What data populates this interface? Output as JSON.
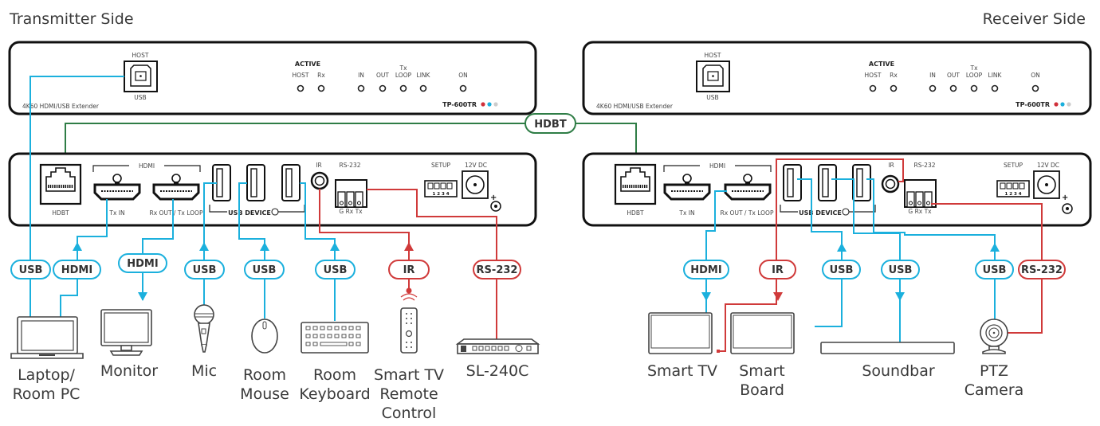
{
  "titles": {
    "transmitter": "Transmitter Side",
    "receiver": "Receiver Side"
  },
  "front_panel": {
    "host_label": "HOST",
    "usb_label": "USB",
    "product_desc": "4K60 HDMI/USB Extender",
    "active_label": "ACTIVE",
    "leds": [
      "HOST",
      "Rx",
      "IN",
      "OUT",
      "LOOP",
      "LINK",
      "ON"
    ],
    "tx_label": "Tx",
    "model": "TP-600TR",
    "model_dots": [
      "#d0303a",
      "#1bb0dd",
      "#cccccc"
    ]
  },
  "rear_panel": {
    "hdbt": "HDBT",
    "hdmi": "HDMI",
    "tx_in": "Tx IN",
    "rx_out": "Rx OUT / Tx LOOP",
    "usb_device": "USB DEVICE",
    "ir": "IR",
    "rs232": "RS-232",
    "rs232_pins": "G Rx Tx",
    "setup": "SETUP",
    "dip": "1 2 3 4",
    "dc": "12V DC"
  },
  "link": {
    "hdbt_label": "HDBT"
  },
  "colors": {
    "usb_hdmi": "#1bb0dd",
    "ir_rs232": "#d03a3a",
    "hdbt": "#2f7d46"
  },
  "transmitter_devices": [
    {
      "name": "Laptop/",
      "name2": "Room PC",
      "connections": [
        "USB",
        "HDMI"
      ]
    },
    {
      "name": "Monitor",
      "connections": [
        "HDMI"
      ]
    },
    {
      "name": "Mic",
      "connections": [
        "USB"
      ]
    },
    {
      "name": "Room",
      "name2": "Mouse",
      "connections": [
        "USB"
      ]
    },
    {
      "name": "Room",
      "name2": "Keyboard",
      "connections": [
        "USB"
      ]
    },
    {
      "name": "Smart TV",
      "name2": "Remote",
      "name3": "Control",
      "connections": [
        "IR"
      ]
    },
    {
      "name": "SL-240C",
      "connections": [
        "RS-232"
      ]
    }
  ],
  "receiver_devices": [
    {
      "name": "Smart TV",
      "connections": [
        "HDMI"
      ]
    },
    {
      "name": "Smart",
      "name2": "Board",
      "connections": [
        "IR",
        "USB"
      ]
    },
    {
      "name": "Soundbar",
      "connections": [
        "USB"
      ]
    },
    {
      "name": "PTZ",
      "name2": "Camera",
      "connections": [
        "USB",
        "RS-232"
      ]
    }
  ]
}
